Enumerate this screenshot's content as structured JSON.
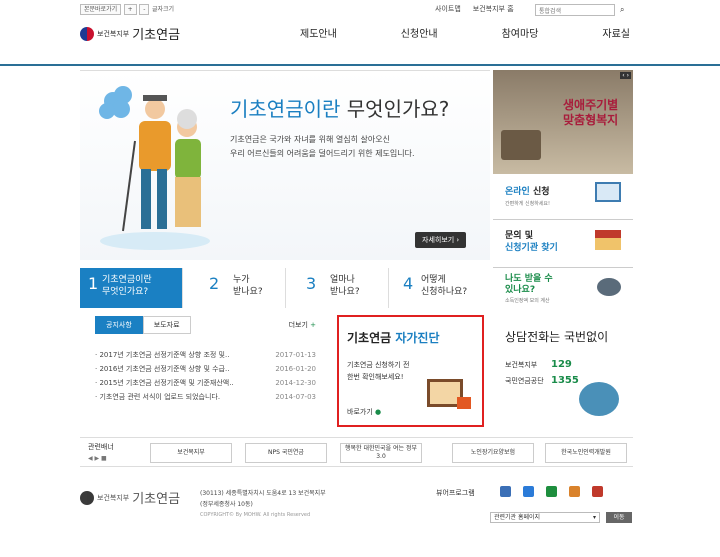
{
  "top": {
    "font_small": "본문바로가기",
    "zoom_in": "+",
    "zoom_out": "-",
    "font_size_label": "글자크기",
    "ministry": "보건복지부",
    "site_title": "기초연금",
    "util": [
      "사이트맵",
      "보건복지부 홈"
    ],
    "search_placeholder": "통합검색",
    "nav": [
      "제도안내",
      "신청안내",
      "참여마당",
      "자료실"
    ]
  },
  "hero": {
    "title_a": "기초연금이란",
    "title_b": " 무엇인가요?",
    "desc1": "기초연금은 국가와 자녀를 위해 열심히 살아오신",
    "desc2": "우리 어르신들의 어려움을 덜어드리기 위한 제도입니다.",
    "detail": "자세히보기"
  },
  "side": {
    "promo_line1": "생애주기별",
    "promo_line2": "맞춤형복지",
    "online_a": "온라인",
    "online_b": " 신청",
    "online_sub": "간편하게 신청하세요!",
    "inquiry": "문의 및",
    "inquiry_b": "신청기관 찾기",
    "me_a": "나도 받을 수",
    "me_b": "있나요?",
    "me_sub": "소득인정액 모의 계산"
  },
  "steps": [
    {
      "num": "1",
      "l1": "기초연금이란",
      "l2": "무엇인가요?"
    },
    {
      "num": "2",
      "l1": "누가",
      "l2": "받나요?"
    },
    {
      "num": "3",
      "l1": "얼마나",
      "l2": "받나요?"
    },
    {
      "num": "4",
      "l1": "어떻게",
      "l2": "신청하나요?"
    }
  ],
  "notice": {
    "tab1": "공지사항",
    "tab2": "보도자료",
    "more": "더보기",
    "items": [
      {
        "t": "2017년 기초연금 선정기준액 상향 조정 및..",
        "d": "2017-01-13"
      },
      {
        "t": "2016년 기초연금 선정기준액 상향 및 수급..",
        "d": "2016-01-20"
      },
      {
        "t": "2015년 기초연금 선정기준액 및 기준재산액..",
        "d": "2014-12-30"
      },
      {
        "t": "기초연금 관련 서식이 업로드 되었습니다.",
        "d": "2014-07-03"
      }
    ]
  },
  "self": {
    "title_a": "기초연금",
    "title_b": " 자가진단",
    "desc1": "기초연금 신청하기 전",
    "desc2": "한번 확인해보세요!",
    "go": "바로가기"
  },
  "call": {
    "title": "상담전화는 국번없이",
    "rows": [
      {
        "org": "보건복지부",
        "num": "129"
      },
      {
        "org": "국민연금공단",
        "num": "1355"
      }
    ]
  },
  "banner": {
    "label": "관련배너",
    "items": [
      "보건복지부",
      "NPS 국민연금",
      "행복한 대한민국을 여는 정부3.0",
      "노인장기요양보험",
      "한국노인인력개발원"
    ]
  },
  "footer": {
    "ministry": "보건복지부",
    "title": "기초연금",
    "addr1": "(30113) 세종특별자치시 도움4로 13 보건복지부",
    "addr2": "(정부세종청사 10동)",
    "copy": "COPYRIGHT© By MOHW. All rights Reserved",
    "viewer": "뷰어프로그램",
    "related": "관련기관 홈페이지",
    "go": "이동"
  }
}
